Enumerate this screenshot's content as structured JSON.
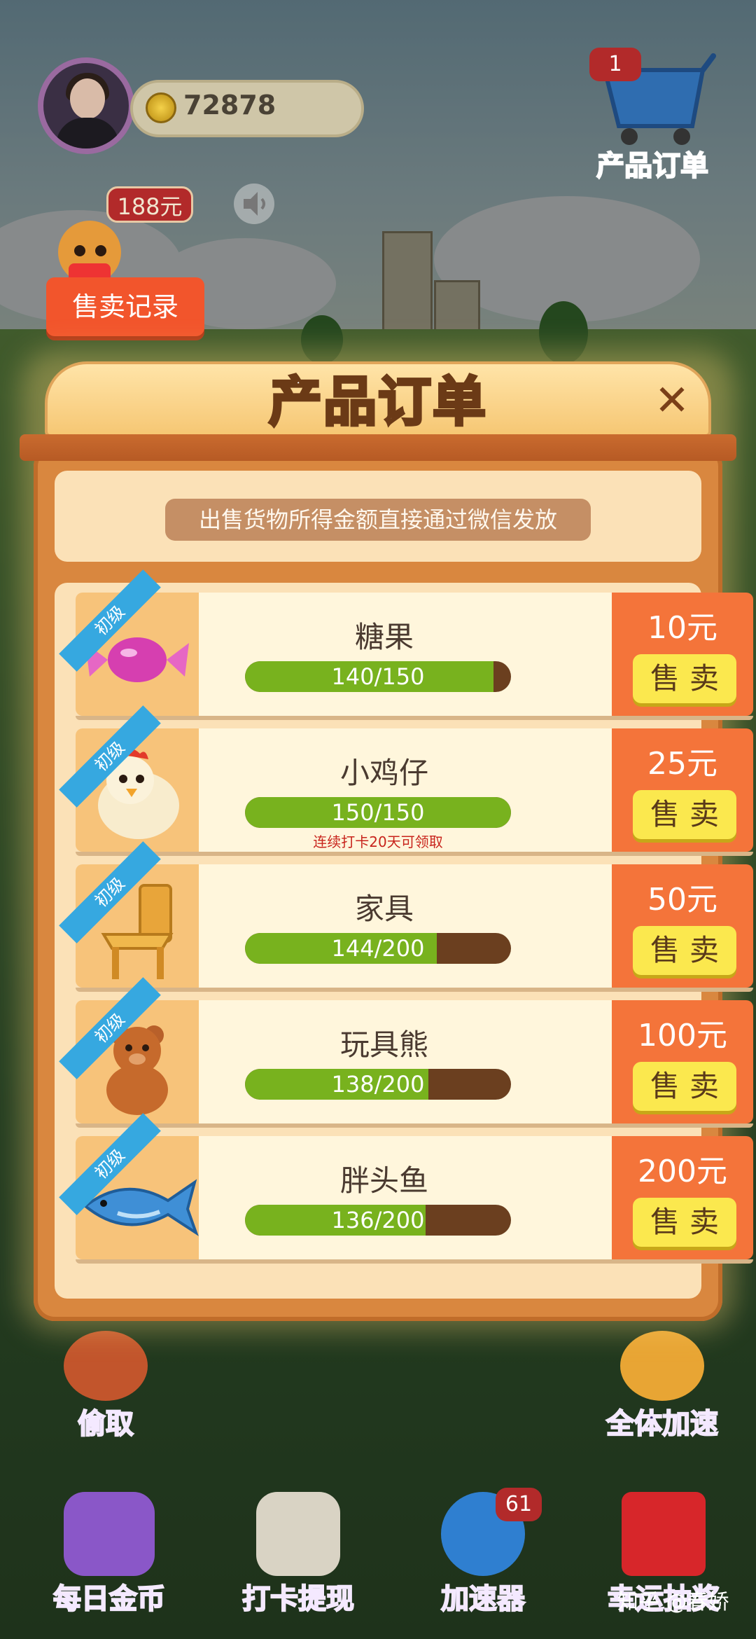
{
  "hud": {
    "coins": "72878",
    "cart_badge": "1",
    "cart_label": "产品订单",
    "money_badge": "188元",
    "sale_record_label": "售卖记录"
  },
  "modal": {
    "title": "产品订单",
    "close_icon": "close-icon",
    "notice": "出售货物所得金额直接通过微信发放",
    "items": [
      {
        "tag": "初级",
        "name": "糖果",
        "progress_text": "140/150",
        "progress": 0.933,
        "price": "10元",
        "sell_label": "售卖",
        "note": ""
      },
      {
        "tag": "初级",
        "name": "小鸡仔",
        "progress_text": "150/150",
        "progress": 1.0,
        "price": "25元",
        "sell_label": "售卖",
        "note": "连续打卡20天可领取"
      },
      {
        "tag": "初级",
        "name": "家具",
        "progress_text": "144/200",
        "progress": 0.72,
        "price": "50元",
        "sell_label": "售卖",
        "note": ""
      },
      {
        "tag": "初级",
        "name": "玩具熊",
        "progress_text": "138/200",
        "progress": 0.69,
        "price": "100元",
        "sell_label": "售卖",
        "note": ""
      },
      {
        "tag": "初级",
        "name": "胖头鱼",
        "progress_text": "136/200",
        "progress": 0.68,
        "price": "200元",
        "sell_label": "售卖",
        "note": ""
      }
    ]
  },
  "bottom": {
    "steal": "偷取",
    "speed_all": "全体加速",
    "daily_gold": "每日金币",
    "checkin": "打卡提现",
    "accelerator": "加速器",
    "accelerator_badge": "61",
    "lucky_draw": "幸运抽奖"
  },
  "watermark": "知乎 @春娇",
  "colors": {
    "sell_panel": "#f4743a",
    "sell_button": "#fbe84e",
    "progress_fill": "#78b21e",
    "ribbon": "#36a8e0"
  }
}
